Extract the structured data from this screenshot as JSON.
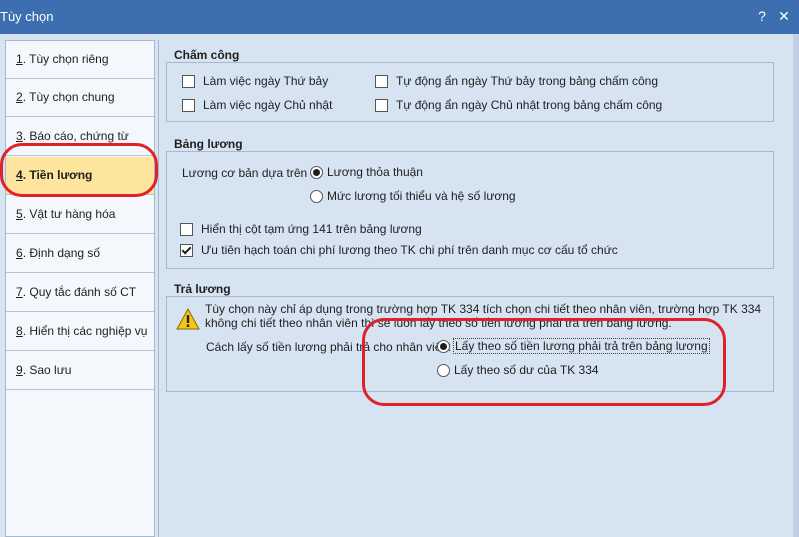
{
  "window": {
    "title": "Tùy chọn",
    "help_glyph": "?",
    "close_glyph": "✕"
  },
  "nav": {
    "items": [
      {
        "num": "1",
        "label": ". Tùy chọn riêng"
      },
      {
        "num": "2",
        "label": ". Tùy chọn chung"
      },
      {
        "num": "3",
        "label": ". Báo cáo, chứng từ"
      },
      {
        "num": "4",
        "label": ". Tiền lương"
      },
      {
        "num": "5",
        "label": ". Vật tư hàng hóa"
      },
      {
        "num": "6",
        "label": ". Định dạng số"
      },
      {
        "num": "7",
        "label": ". Quy tắc đánh số CT"
      },
      {
        "num": "8",
        "label": ". Hiển thị các nghiệp vụ"
      },
      {
        "num": "9",
        "label": ". Sao lưu"
      }
    ],
    "active_index": 3
  },
  "cham_cong": {
    "title": "Chấm công",
    "options": [
      {
        "label": "Làm việc ngày Thứ bảy",
        "checked": false
      },
      {
        "label": "Làm việc ngày Chủ nhật",
        "checked": false
      },
      {
        "label": "Tự động ẩn ngày Thứ bảy trong bảng chấm công",
        "checked": false
      },
      {
        "label": "Tự động ẩn ngày Chủ nhật trong bảng chấm công",
        "checked": false
      }
    ]
  },
  "bang_luong": {
    "title": "Bảng lương",
    "basis_label": "Lương cơ bản dựa trên",
    "radios": [
      {
        "label": "Lương thỏa thuận",
        "selected": true
      },
      {
        "label": "Mức lương tối thiểu và hệ số lương",
        "selected": false
      }
    ],
    "checks": [
      {
        "label": "Hiển thị cột tạm ứng 141 trên bảng lương",
        "checked": false
      },
      {
        "label": "Ưu tiên hạch toán chi phí lương theo TK chi phí trên danh mục cơ cấu tổ chức",
        "checked": true
      }
    ]
  },
  "tra_luong": {
    "title": "Trả lương",
    "note_line1": "Tùy chọn này chỉ áp dụng trong trường hợp TK 334 tích chọn chi tiết theo nhân viên, trường hợp TK 334",
    "note_line2": "không chi tiết theo nhân viên thì sẽ luôn lấy theo số tiền lương phải trả trên bảng lương.",
    "method_label": "Cách lấy số tiền lương phải trả cho nhân viên:",
    "radios": [
      {
        "label": "Lấy theo số tiền lương phải trả trên bảng lương",
        "selected": true
      },
      {
        "label": "Lấy theo số dư của TK 334",
        "selected": false
      }
    ]
  },
  "colors": {
    "title_bar": "#3d6fb0",
    "panel": "#d6e4f2",
    "active_nav": "#fde59e",
    "annotation": "#e0202a"
  }
}
